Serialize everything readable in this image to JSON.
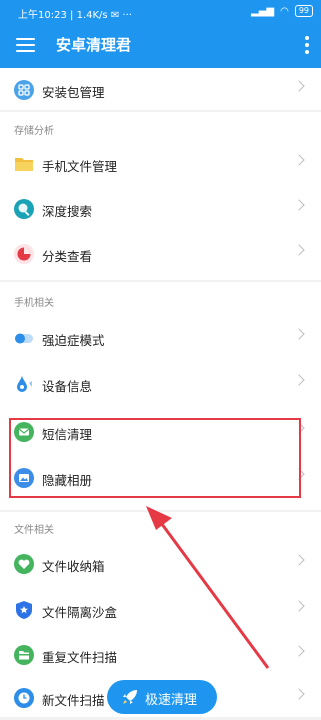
{
  "status_bar": {
    "time": "上午10:23",
    "network_speed": "1.4K/s",
    "battery": "99"
  },
  "app_bar": {
    "title": "安卓清理君"
  },
  "sections": {
    "top": {
      "items": [
        {
          "label": "安装包管理",
          "icon": "package-icon",
          "icon_color": "#4aa3e8"
        }
      ]
    },
    "storage": {
      "header": "存储分析",
      "items": [
        {
          "label": "手机文件管理",
          "icon": "folder-icon",
          "icon_color": "#f3c040"
        },
        {
          "label": "深度搜索",
          "icon": "search-icon",
          "icon_color": "#1aa3b6"
        },
        {
          "label": "分类查看",
          "icon": "pie-chart-icon",
          "icon_color": "#e53945"
        }
      ]
    },
    "phone": {
      "header": "手机相关",
      "items": [
        {
          "label": "强迫症模式",
          "icon": "toggle-icon",
          "icon_color": "#2c8ee8"
        },
        {
          "label": "设备信息",
          "icon": "device-drop-icon",
          "icon_color": "#2c8ee8"
        },
        {
          "label": "短信清理",
          "icon": "message-icon",
          "icon_color": "#45b45e"
        },
        {
          "label": "隐藏相册",
          "icon": "album-icon",
          "icon_color": "#3b8de8"
        }
      ]
    },
    "files": {
      "header": "文件相关",
      "items": [
        {
          "label": "文件收纳箱",
          "icon": "heart-box-icon",
          "icon_color": "#45b45e"
        },
        {
          "label": "文件隔离沙盒",
          "icon": "shield-star-icon",
          "icon_color": "#2c73e8"
        },
        {
          "label": "重复文件扫描",
          "icon": "folder-duplicate-icon",
          "icon_color": "#45b45e"
        },
        {
          "label": "新文件扫描",
          "icon": "clock-icon",
          "icon_color": "#2c8ee8"
        }
      ]
    }
  },
  "fab": {
    "label": "极速清理",
    "icon": "rocket-icon"
  },
  "annotation": {
    "color": "#e53945"
  }
}
